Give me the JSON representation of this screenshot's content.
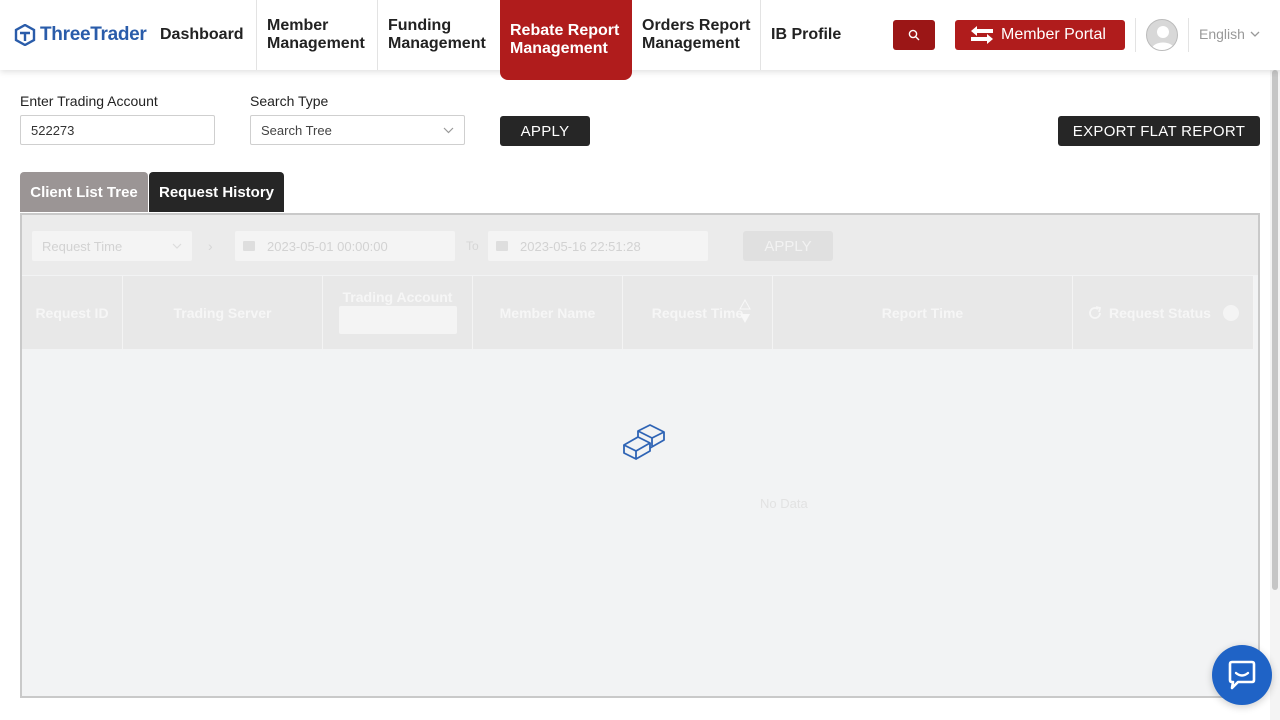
{
  "brand": {
    "name": "ThreeTrader",
    "color": "#2a5caa"
  },
  "nav": {
    "items": [
      {
        "label": "Dashboard"
      },
      {
        "label": "Member Management"
      },
      {
        "label": "Funding Management"
      },
      {
        "label": "Rebate Report Management",
        "active": true
      },
      {
        "label": "Orders Report Management"
      },
      {
        "label": "IB Profile"
      }
    ],
    "search_icon": "search-icon",
    "portal_label": "Member Portal",
    "language": "English"
  },
  "form": {
    "account_label": "Enter Trading Account",
    "account_value": "522273",
    "search_type_label": "Search Type",
    "search_type_value": "Search Tree",
    "apply_label": "APPLY",
    "export_label": "EXPORT FLAT REPORT"
  },
  "tabs": [
    {
      "label": "Client List Tree",
      "active": false
    },
    {
      "label": "Request History",
      "active": true
    }
  ],
  "history": {
    "filter_select": "Request Time",
    "date_from": "2023-05-01 00:00:00",
    "to_label": "To",
    "date_to": "2023-05-16 22:51:28",
    "apply_label": "APPLY",
    "columns": [
      "Request ID",
      "Trading Server",
      "Trading Account",
      "Member Name",
      "Request Time",
      "Report Time",
      "Request Status"
    ],
    "empty_text": "No Data"
  },
  "colors": {
    "accent": "#b01c1c",
    "dark_button": "#262626",
    "chat": "#1f63c6"
  }
}
